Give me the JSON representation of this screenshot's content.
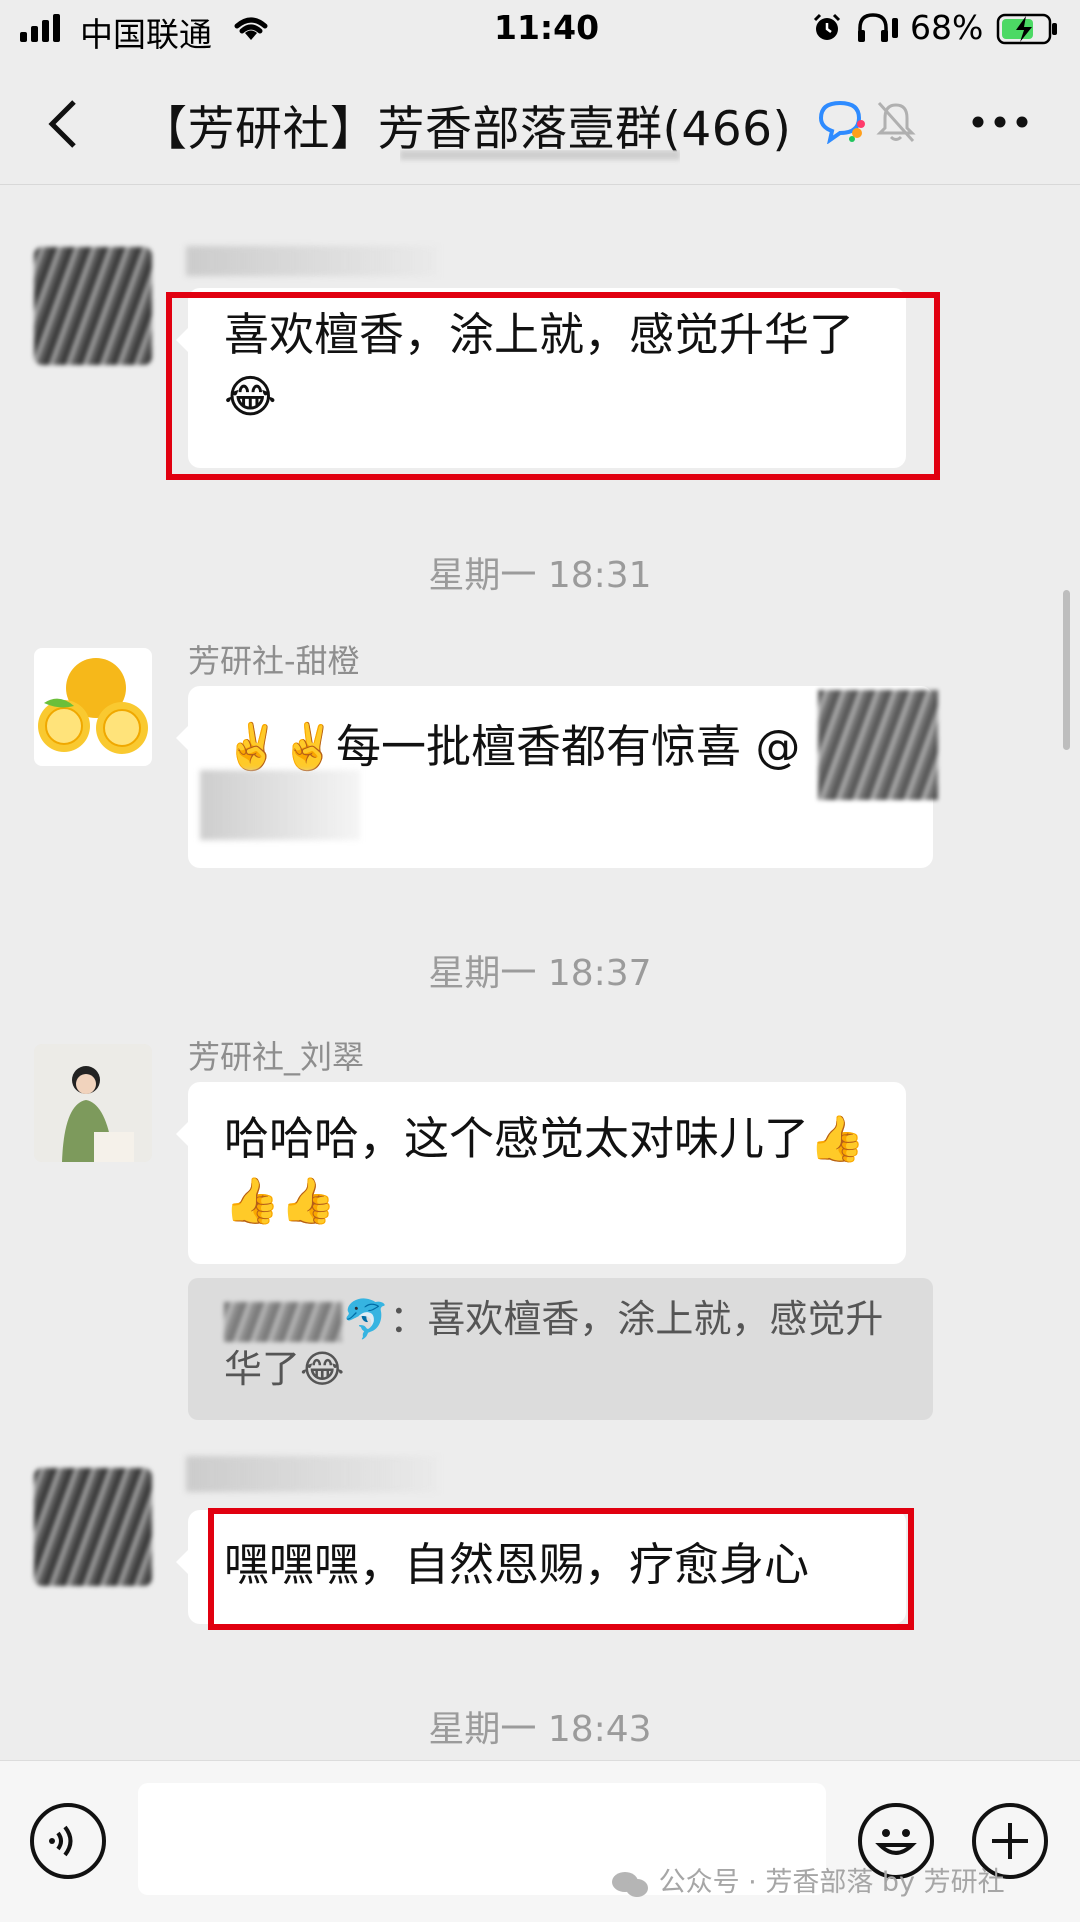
{
  "status_bar": {
    "carrier": "中国联通",
    "time": "11:40",
    "battery": "68%"
  },
  "header": {
    "title": "【芳研社】芳香部落壹群(466)",
    "back_icon": "chevron-left-icon",
    "chat_icon": "chat-bubble-icon",
    "mute_icon": "bell-muted-icon",
    "more_icon": "more-dots-icon"
  },
  "messages": [
    {
      "sender": "",
      "text": "喜欢檀香，涂上就，感觉升华了😂",
      "highlighted": true
    },
    {
      "timestamp": "星期一 18:31",
      "sender": "芳研社-甜橙",
      "text": "✌️✌️每一批檀香都有惊喜 @"
    },
    {
      "timestamp": "星期一 18:37",
      "sender": "芳研社_刘翠",
      "text": "哈哈哈，这个感觉太对味儿了👍👍👍",
      "quote": "🐬：喜欢檀香，涂上就，感觉升华了😂"
    },
    {
      "sender": "",
      "text": "嘿嘿嘿，自然恩赐，疗愈身心",
      "highlighted": true
    }
  ],
  "bottom_timestamp": "星期一 18:43",
  "input_bar": {
    "voice_icon": "voice-icon",
    "emoji_icon": "emoji-icon",
    "plus_icon": "plus-icon"
  },
  "watermark": "公众号 · 芳香部落 by 芳研社",
  "colors": {
    "background": "#ededed",
    "bubble": "#ffffff",
    "highlight": "#e10010"
  }
}
